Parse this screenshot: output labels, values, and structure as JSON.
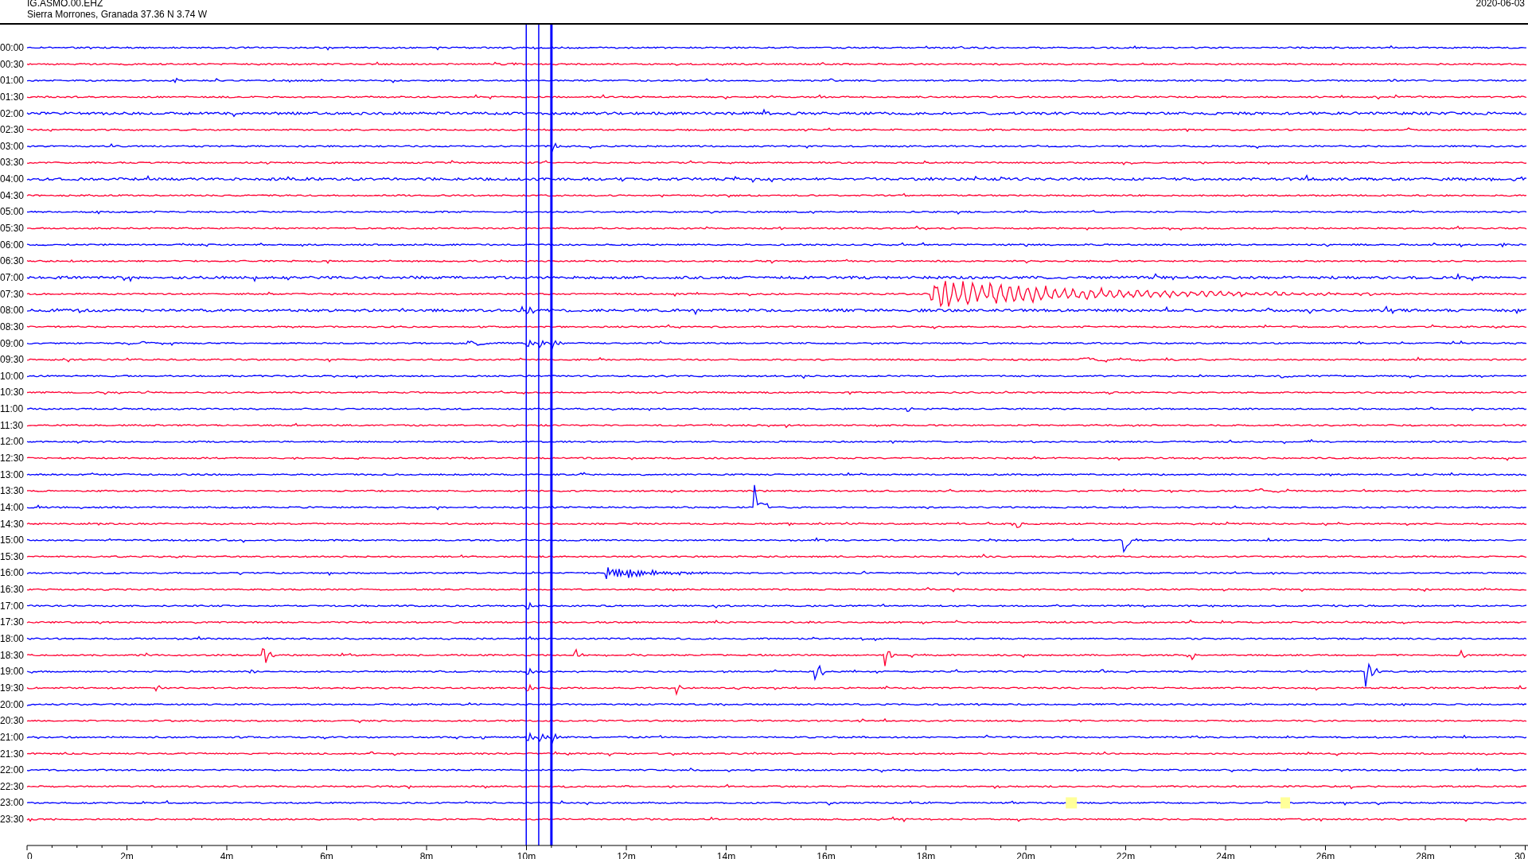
{
  "header": {
    "station": "IG.ASMO.00.EHZ",
    "location": "Sierra Morrones, Granada  37.36 N 3.74 W",
    "date": "2020-06-03"
  },
  "rows": [
    {
      "label": "00:00",
      "color": "#0000ff"
    },
    {
      "label": "00:30",
      "color": "#ff0033"
    },
    {
      "label": "01:00",
      "color": "#0000ff"
    },
    {
      "label": "01:30",
      "color": "#ff0033"
    },
    {
      "label": "02:00",
      "color": "#0000ff"
    },
    {
      "label": "02:30",
      "color": "#ff0033"
    },
    {
      "label": "03:00",
      "color": "#0000ff"
    },
    {
      "label": "03:30",
      "color": "#ff0033"
    },
    {
      "label": "04:00",
      "color": "#0000ff"
    },
    {
      "label": "04:30",
      "color": "#ff0033"
    },
    {
      "label": "05:00",
      "color": "#0000ff"
    },
    {
      "label": "05:30",
      "color": "#ff0033"
    },
    {
      "label": "06:00",
      "color": "#0000ff"
    },
    {
      "label": "06:30",
      "color": "#ff0033"
    },
    {
      "label": "07:00",
      "color": "#0000ff"
    },
    {
      "label": "07:30",
      "color": "#ff0033"
    },
    {
      "label": "08:00",
      "color": "#0000ff"
    },
    {
      "label": "08:30",
      "color": "#ff0033"
    },
    {
      "label": "09:00",
      "color": "#0000ff"
    },
    {
      "label": "09:30",
      "color": "#ff0033"
    },
    {
      "label": "10:00",
      "color": "#0000ff"
    },
    {
      "label": "10:30",
      "color": "#ff0033"
    },
    {
      "label": "11:00",
      "color": "#0000ff"
    },
    {
      "label": "11:30",
      "color": "#ff0033"
    },
    {
      "label": "12:00",
      "color": "#0000ff"
    },
    {
      "label": "12:30",
      "color": "#ff0033"
    },
    {
      "label": "13:00",
      "color": "#0000ff"
    },
    {
      "label": "13:30",
      "color": "#ff0033"
    },
    {
      "label": "14:00",
      "color": "#0000ff"
    },
    {
      "label": "14:30",
      "color": "#ff0033"
    },
    {
      "label": "15:00",
      "color": "#0000ff"
    },
    {
      "label": "15:30",
      "color": "#ff0033"
    },
    {
      "label": "16:00",
      "color": "#0000ff"
    },
    {
      "label": "16:30",
      "color": "#ff0033"
    },
    {
      "label": "17:00",
      "color": "#0000ff"
    },
    {
      "label": "17:30",
      "color": "#ff0033"
    },
    {
      "label": "18:00",
      "color": "#0000ff"
    },
    {
      "label": "18:30",
      "color": "#ff0033"
    },
    {
      "label": "19:00",
      "color": "#0000ff"
    },
    {
      "label": "19:30",
      "color": "#ff0033"
    },
    {
      "label": "20:00",
      "color": "#0000ff"
    },
    {
      "label": "20:30",
      "color": "#ff0033"
    },
    {
      "label": "21:00",
      "color": "#0000ff"
    },
    {
      "label": "21:30",
      "color": "#ff0033"
    },
    {
      "label": "22:00",
      "color": "#0000ff"
    },
    {
      "label": "22:30",
      "color": "#ff0033"
    },
    {
      "label": "23:00",
      "color": "#0000ff"
    },
    {
      "label": "23:30",
      "color": "#ff0033"
    }
  ],
  "x_axis": [
    "0",
    "2m",
    "4m",
    "6m",
    "8m",
    "10m",
    "12m",
    "14m",
    "16m",
    "18m",
    "20m",
    "22m",
    "24m",
    "26m",
    "28m",
    "30"
  ]
}
